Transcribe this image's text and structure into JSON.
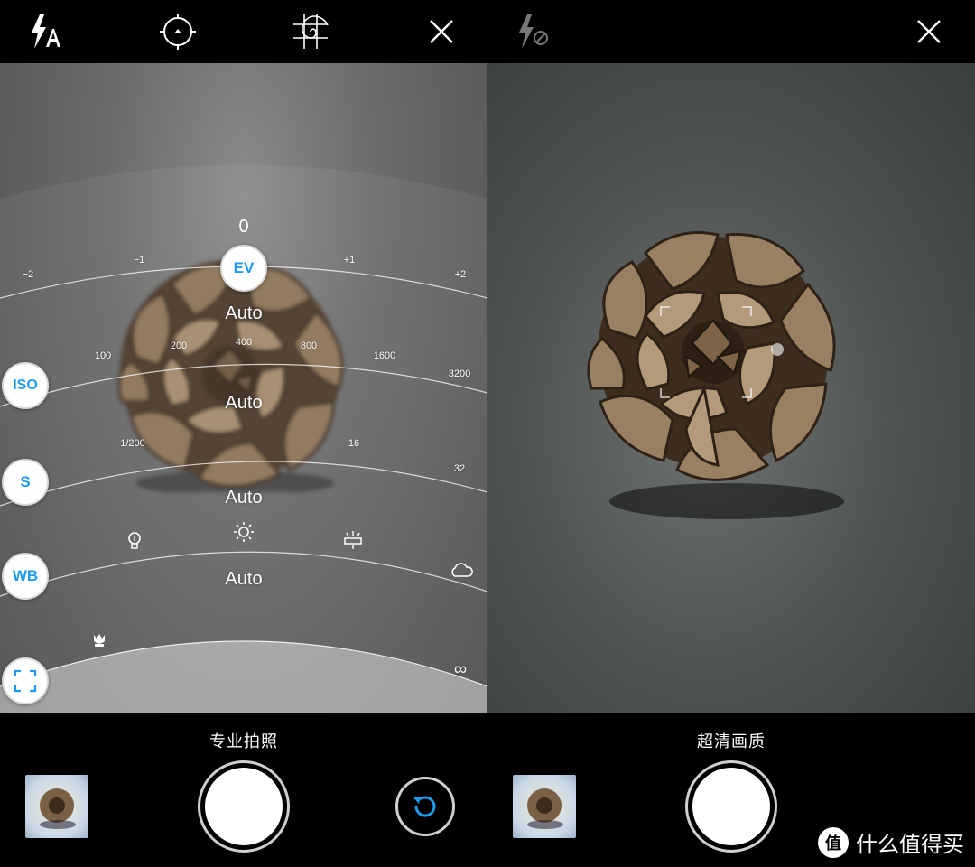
{
  "left": {
    "topbar": {
      "icons": [
        "flash-auto-icon",
        "focus-icon",
        "golden-spiral-grid-icon",
        "close-icon"
      ]
    },
    "pro": {
      "ev": {
        "value": "0",
        "button": "EV",
        "ticks": [
          "−2",
          "−1",
          "+1",
          "+2"
        ],
        "status": "Auto"
      },
      "iso": {
        "button": "ISO",
        "ticks": [
          "100",
          "200",
          "400",
          "800",
          "1600",
          "3200"
        ],
        "status": "Auto"
      },
      "shutter": {
        "button": "S",
        "ticks": [
          "1/200",
          "16",
          "32"
        ],
        "status": "Auto"
      },
      "wb": {
        "button": "WB",
        "icons": [
          "incandescent-icon",
          "daylight-icon",
          "fluorescent-icon",
          "cloudy-icon"
        ],
        "status": "Auto"
      },
      "focus": {
        "button_icon": "focus-frame-icon",
        "macro_icon": "macro-flower-icon",
        "infinity": "∞"
      }
    },
    "mode_label": "专业拍照",
    "gallery_thumb": "gallery-thumbnail",
    "reset_icon": "rotate-reset-icon"
  },
  "right": {
    "topbar": {
      "icons": [
        "flash-off-icon",
        "close-icon"
      ]
    },
    "mode_label": "超清画质",
    "gallery_thumb": "gallery-thumbnail"
  },
  "watermark": {
    "logo": "值",
    "text": "什么值得买"
  },
  "colors": {
    "accent": "#1e9be8",
    "background": "#000000",
    "text": "#ffffff"
  }
}
